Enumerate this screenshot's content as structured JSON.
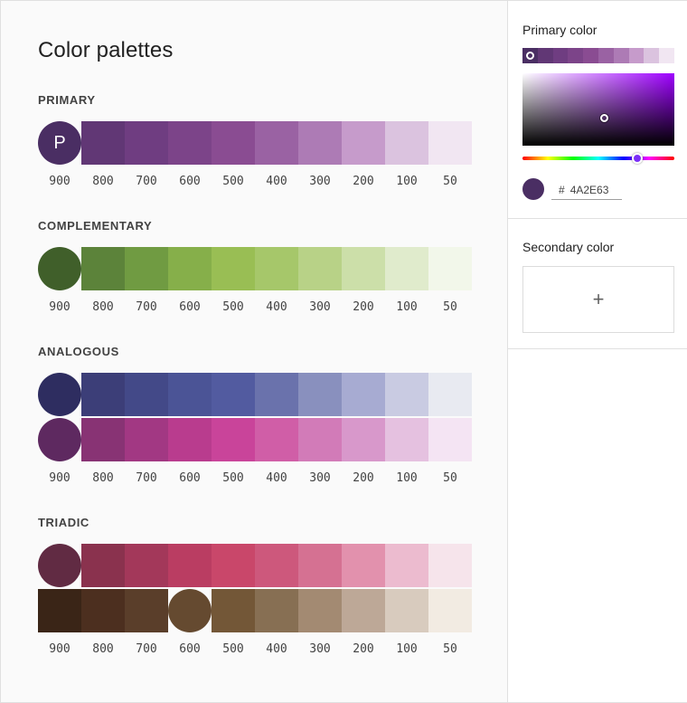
{
  "page_title": "Color palettes",
  "shade_labels": [
    "900",
    "800",
    "700",
    "600",
    "500",
    "400",
    "300",
    "200",
    "100",
    "50"
  ],
  "sections": [
    {
      "title": "PRIMARY",
      "rows": [
        {
          "circle_index": 0,
          "circle_letter": "P",
          "colors": [
            "#4A2E63",
            "#613775",
            "#6F3D81",
            "#7C4489",
            "#8A4C92",
            "#9A62A3",
            "#AD7BB5",
            "#C69BCB",
            "#DBC3DF",
            "#F1E6F2"
          ]
        }
      ]
    },
    {
      "title": "COMPLEMENTARY",
      "rows": [
        {
          "circle_index": 0,
          "circle_letter": "",
          "colors": [
            "#405F2A",
            "#5C833A",
            "#709B42",
            "#86AF4A",
            "#99BE54",
            "#A6C76A",
            "#B8D287",
            "#CCDFA9",
            "#E0EBCC",
            "#F2F7EA"
          ]
        }
      ]
    },
    {
      "title": "ANALOGOUS",
      "rows": [
        {
          "circle_index": 0,
          "circle_letter": "",
          "colors": [
            "#2E2D60",
            "#3C3E78",
            "#434988",
            "#4B5496",
            "#525BA0",
            "#6A72AC",
            "#8990BE",
            "#A7ABD2",
            "#C9CBE2",
            "#E8EAF1"
          ]
        },
        {
          "circle_index": 0,
          "circle_letter": "",
          "colors": [
            "#5E2960",
            "#883374",
            "#A23883",
            "#B93C8E",
            "#C9449A",
            "#D05EA7",
            "#D27BB8",
            "#D898CB",
            "#E5C1E0",
            "#F4E4F3"
          ]
        }
      ]
    },
    {
      "title": "TRIADIC",
      "rows": [
        {
          "circle_index": 0,
          "circle_letter": "",
          "colors": [
            "#612B43",
            "#8A324E",
            "#A3385A",
            "#BA3D62",
            "#C9476A",
            "#CD587C",
            "#D57192",
            "#E291AD",
            "#ECBBCF",
            "#F6E4EB"
          ]
        },
        {
          "circle_index": 3,
          "circle_letter": "",
          "colors": [
            "#3A2517",
            "#4C2F1F",
            "#5A3E2A",
            "#654A30",
            "#735737",
            "#876F53",
            "#A38A72",
            "#BDA897",
            "#D8CBBE",
            "#F2EBE2"
          ]
        }
      ]
    }
  ],
  "panel": {
    "primary_label": "Primary color",
    "primary_hex": "4A2E63",
    "hex_prefix": "#",
    "primary_color": "#4A2E63",
    "secondary_label": "Secondary color",
    "add_label": "+"
  },
  "icons": {
    "add": "plus-icon"
  }
}
